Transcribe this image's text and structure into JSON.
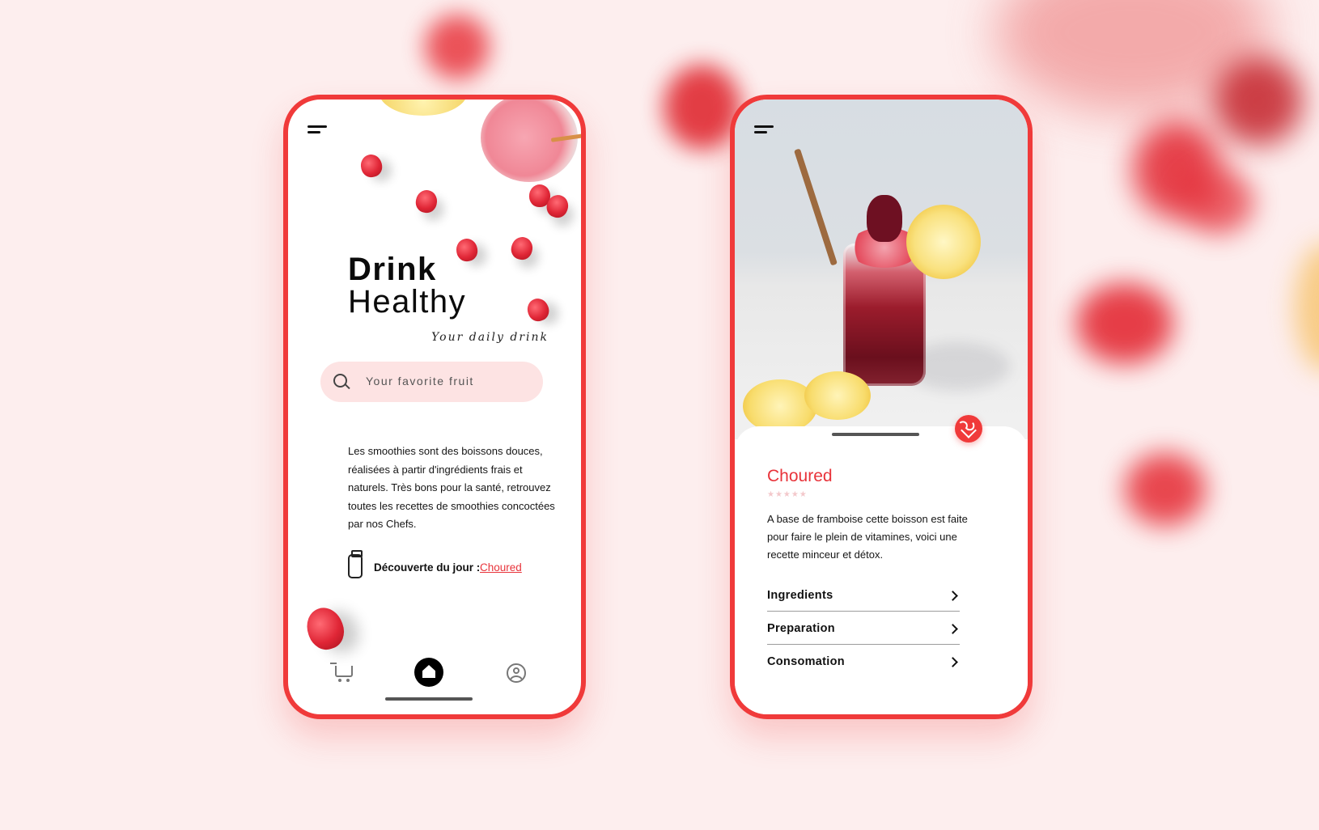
{
  "home": {
    "title_line1": "Drink",
    "title_line2": "Healthy",
    "tagline": "Your daily drink",
    "search": {
      "placeholder": "Your favorite fruit"
    },
    "description": "Les smoothies sont des boissons douces,  réalisées à partir d'ingrédients frais et naturels. Très bons pour la santé, retrouvez toutes les recettes de smoothies concoctées par nos Chefs.",
    "discover_label": "Découverte du jour :",
    "discover_link": "Choured",
    "tabbar": [
      "cart-icon",
      "home-icon",
      "profile-icon"
    ]
  },
  "detail": {
    "name": "Choured",
    "rating": 5,
    "stars_text": "★★★★★",
    "description": "A base de framboise cette boisson est faite pour faire le plein de vitamines, voici une recette minceur et détox.",
    "menu": [
      {
        "label": "Ingredients"
      },
      {
        "label": "Preparation"
      },
      {
        "label": "Consomation"
      }
    ]
  },
  "colors": {
    "accent": "#f03a3a",
    "background": "#fdeeee",
    "search_bg": "#fde3e3"
  }
}
